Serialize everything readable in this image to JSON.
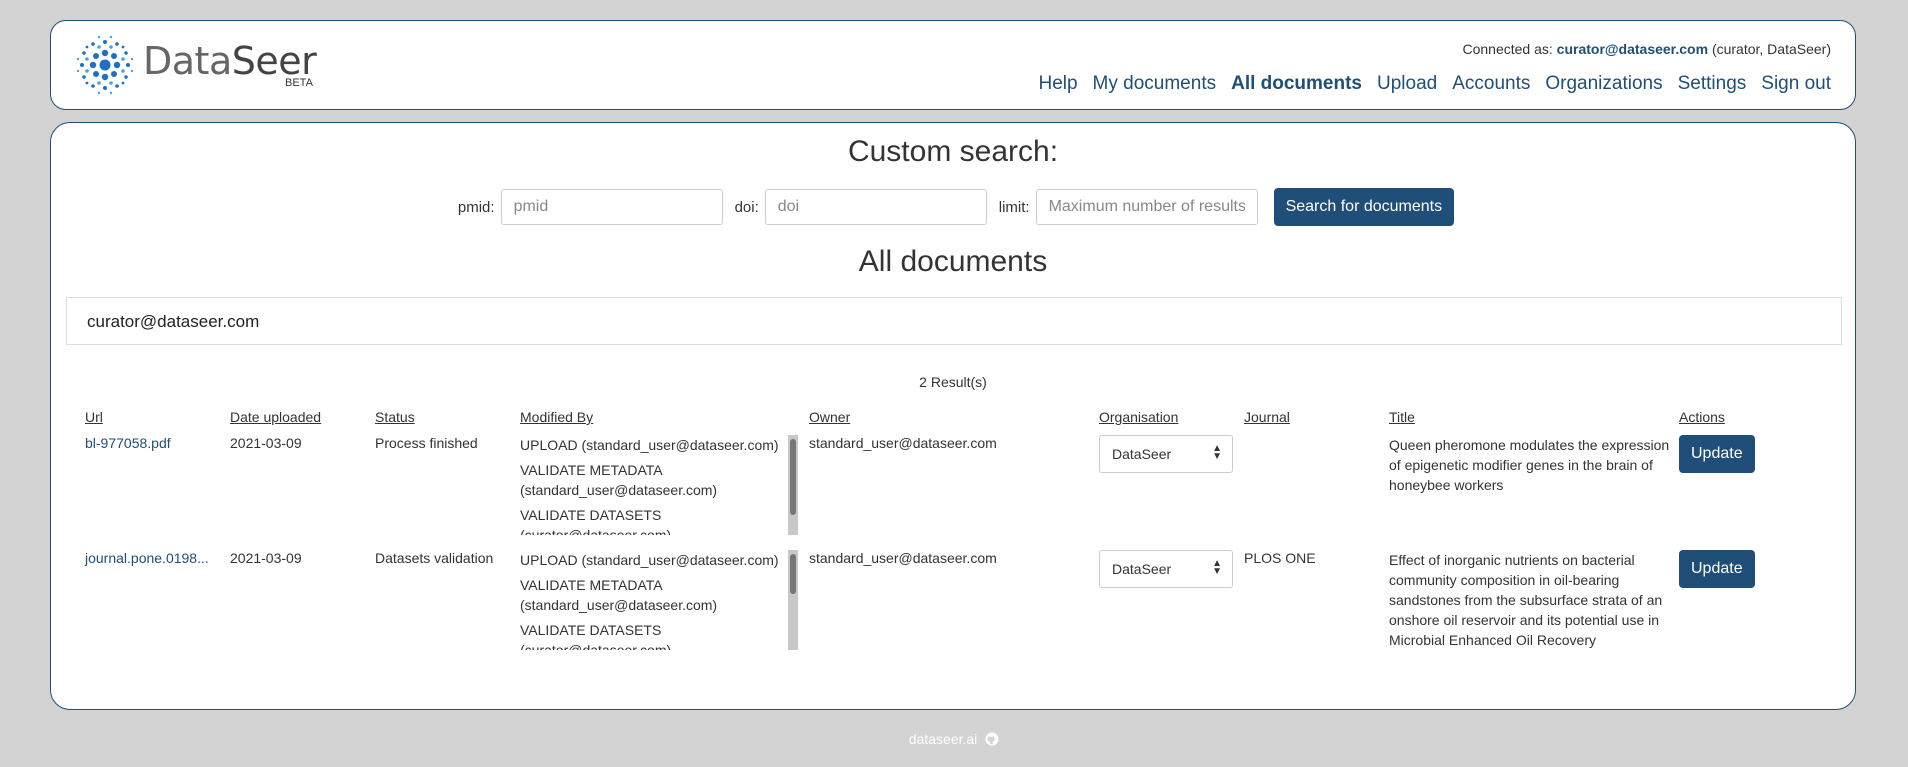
{
  "brand": {
    "name_light": "Data",
    "name_bold": "Seer",
    "beta": "BETA"
  },
  "header": {
    "connected_prefix": "Connected as:",
    "user_email": "curator@dataseer.com",
    "user_role": "(curator, DataSeer)",
    "nav": [
      "Help",
      "My documents",
      "All documents",
      "Upload",
      "Accounts",
      "Organizations",
      "Settings",
      "Sign out"
    ],
    "active_nav": "All documents"
  },
  "search": {
    "title": "Custom search:",
    "pmid_label": "pmid:",
    "pmid_placeholder": "pmid",
    "doi_label": "doi:",
    "doi_placeholder": "doi",
    "limit_label": "limit:",
    "limit_placeholder": "Maximum number of results",
    "button": "Search for documents"
  },
  "documents": {
    "title": "All documents",
    "user_filter": "curator@dataseer.com",
    "results": "2 Result(s)",
    "columns": [
      "Url",
      "Date uploaded",
      "Status",
      "Modified By",
      "Owner",
      "Organisation",
      "Journal",
      "Title",
      "Actions"
    ],
    "rows": [
      {
        "url": "bl-977058.pdf",
        "date": "2021-03-09",
        "status": "Process finished",
        "modified_by": [
          "UPLOAD (standard_user@dataseer.com)",
          "VALIDATE METADATA (standard_user@dataseer.com)",
          "VALIDATE DATASETS (curator@dataseer.com)"
        ],
        "owner": "standard_user@dataseer.com",
        "organisation": "DataSeer",
        "journal": "",
        "title": "Queen pheromone modulates the expression of epigenetic modifier genes in the brain of honeybee workers",
        "action": "Update"
      },
      {
        "url": "journal.pone.0198...",
        "date": "2021-03-09",
        "status": "Datasets validation",
        "modified_by": [
          "UPLOAD (standard_user@dataseer.com)",
          "VALIDATE METADATA (standard_user@dataseer.com)",
          "VALIDATE DATASETS (curator@dataseer.com)"
        ],
        "owner": "standard_user@dataseer.com",
        "organisation": "DataSeer",
        "journal": "PLOS ONE",
        "title": "Effect of inorganic nutrients on bacterial community composition in oil-bearing sandstones from the subsurface strata of an onshore oil reservoir and its potential use in Microbial Enhanced Oil Recovery",
        "action": "Update"
      }
    ]
  },
  "footer": {
    "text": "dataseer.ai"
  },
  "colors": {
    "primary": "#1f4e79",
    "background": "#d3d3d3"
  }
}
